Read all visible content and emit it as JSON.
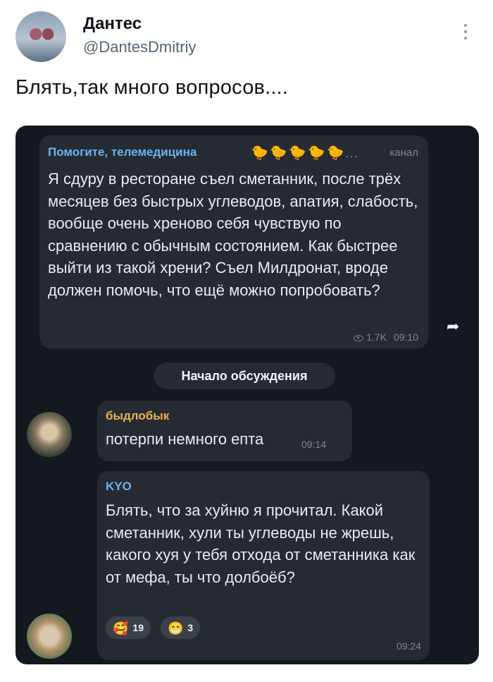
{
  "tweet": {
    "author_name": "Дантес",
    "author_handle": "@DantesDmitriy",
    "text": "Блять,так много вопросов...."
  },
  "chat": {
    "channel_post": {
      "channel_name": "Помогите, телемедицина",
      "emoji": "🐤🐤🐤🐤🐤",
      "ellipsis": "...",
      "tag": "канал",
      "text": "Я сдуру в ресторане съел сметанник, после трёх месяцев без быстрых углеводов, апатия, слабость, вообще очень хреново себя чувствую по сравнению с обычным состоянием. Как быстрее выйти из такой хрени? Съел Милдронат, вроде должен помочь, что ещё можно попробовать?",
      "views": "1.7K",
      "time": "09:10"
    },
    "service_message": "Начало обсуждения",
    "replies": [
      {
        "author": "быдлобык",
        "text": "потерпи немного епта",
        "time": "09:14"
      },
      {
        "author": "KYO",
        "text": "Блять, что за хуйню я прочитал. Какой сметанник, хули ты углеводы не жрешь, какого хуя у тебя отхода от сметанника как от мефа, ты что долбоёб?",
        "time": "09:24",
        "reactions": [
          {
            "emoji": "🥰",
            "count": "19"
          },
          {
            "emoji": "😁",
            "count": "3"
          }
        ]
      }
    ]
  },
  "icons": {
    "more": "more-vertical-icon",
    "forward": "forward-icon",
    "views": "eye-icon"
  },
  "colors": {
    "chat_bg": "#14181f",
    "bubble_bg": "#262b33",
    "link_blue": "#6ab3f2",
    "author_orange": "#e9b14c"
  }
}
